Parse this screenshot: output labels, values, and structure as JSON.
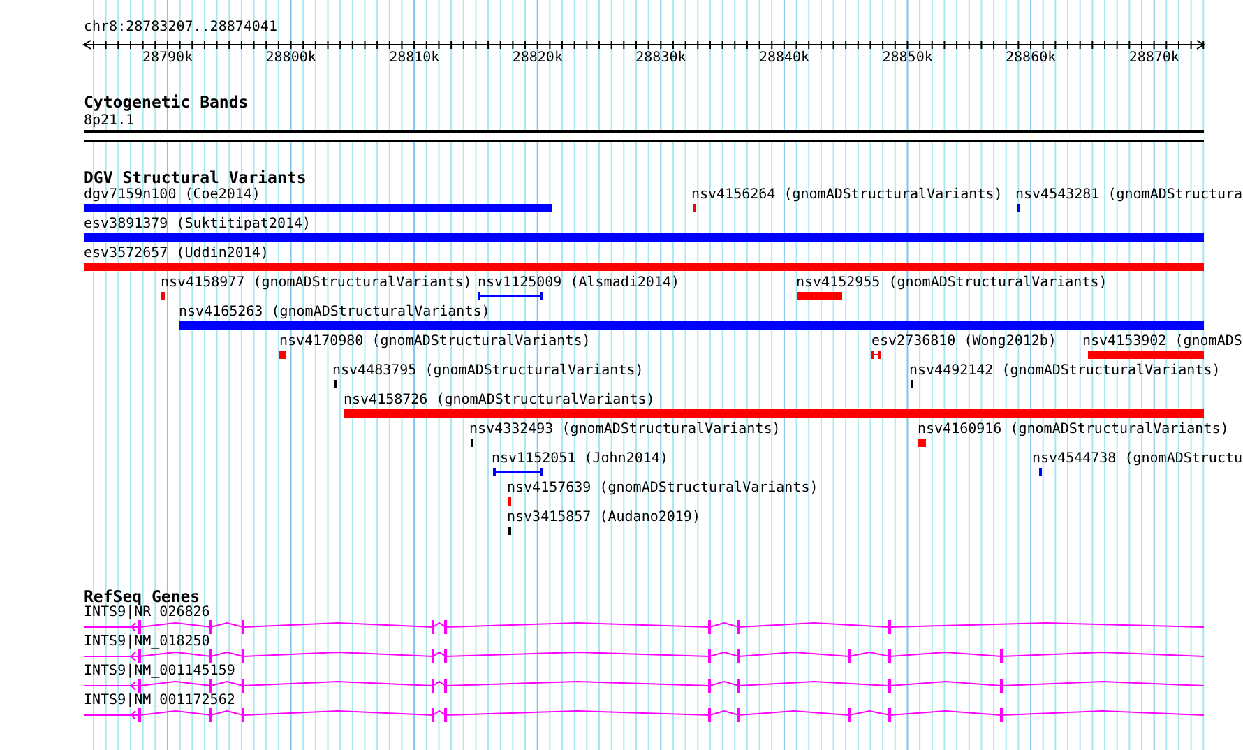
{
  "ruler": {
    "location": "chr8:28783207..28874041",
    "ticks": [
      "28790k",
      "28800k",
      "28810k",
      "28820k",
      "28830k",
      "28840k",
      "28850k",
      "28860k",
      "28870k"
    ]
  },
  "cytogenetic_bands": {
    "title": "Cytogenetic Bands",
    "bands": [
      {
        "label": "8p21.1"
      }
    ]
  },
  "dgv_structural_variants": {
    "title": "DGV Structural Variants",
    "features": [
      {
        "label": "dgv7159n100 (Coe2014)",
        "kind": "bar",
        "color": "#0000ff"
      },
      {
        "label": "nsv4156264 (gnomADStructuralVariants)",
        "kind": "bar",
        "color": "#ff0000"
      },
      {
        "label": "nsv4543281 (gnomADStructura",
        "kind": "bar",
        "color": "#0000ff"
      },
      {
        "label": "esv3891379 (Suktitipat2014)",
        "kind": "bar",
        "color": "#0000ff"
      },
      {
        "label": "esv3572657 (Uddin2014)",
        "kind": "bar",
        "color": "#ff0000"
      },
      {
        "label": "nsv4158977 (gnomADStructuralVariants)",
        "kind": "bar",
        "color": "#ff0000"
      },
      {
        "label": "nsv1125009 (Alsmadi2014)",
        "kind": "interval",
        "color": "#0000ff"
      },
      {
        "label": "nsv4152955 (gnomADStructuralVariants)",
        "kind": "bar",
        "color": "#ff0000"
      },
      {
        "label": "nsv4165263 (gnomADStructuralVariants)",
        "kind": "bar",
        "color": "#0000ff"
      },
      {
        "label": "nsv4170980 (gnomADStructuralVariants)",
        "kind": "bar",
        "color": "#ff0000"
      },
      {
        "label": "esv2736810 (Wong2012b)",
        "kind": "interval",
        "color": "#ff0000"
      },
      {
        "label": "nsv4153902 (gnomADS",
        "kind": "bar",
        "color": "#ff0000"
      },
      {
        "label": "nsv4483795 (gnomADStructuralVariants)",
        "kind": "bar",
        "color": "#000000"
      },
      {
        "label": "nsv4492142 (gnomADStructuralVariants)",
        "kind": "bar",
        "color": "#000000"
      },
      {
        "label": "nsv4158726 (gnomADStructuralVariants)",
        "kind": "bar",
        "color": "#ff0000"
      },
      {
        "label": "nsv4332493 (gnomADStructuralVariants)",
        "kind": "bar",
        "color": "#000000"
      },
      {
        "label": "nsv4160916 (gnomADStructuralVariants)",
        "kind": "bar",
        "color": "#ff0000"
      },
      {
        "label": "nsv1152051 (John2014)",
        "kind": "interval",
        "color": "#0000ff"
      },
      {
        "label": "nsv4544738 (gnomADStructu",
        "kind": "bar",
        "color": "#0000ff"
      },
      {
        "label": "nsv4157639 (gnomADStructuralVariants)",
        "kind": "bar",
        "color": "#ff0000"
      },
      {
        "label": "nsv3415857 (Audano2019)",
        "kind": "bar",
        "color": "#000000"
      }
    ]
  },
  "refseq_genes": {
    "title": "RefSeq Genes",
    "genes": [
      {
        "label": "INTS9|NR_026826"
      },
      {
        "label": "INTS9|NM_018250"
      },
      {
        "label": "INTS9|NM_001145159"
      },
      {
        "label": "INTS9|NM_001172562"
      }
    ]
  }
}
